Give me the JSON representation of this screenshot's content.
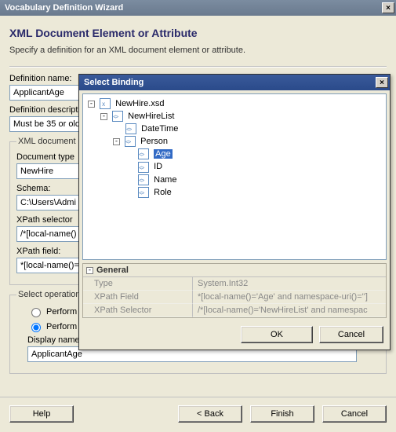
{
  "wizard": {
    "title": "Vocabulary Definition Wizard",
    "header": "XML Document Element or Attribute",
    "description": "Specify a definition for an XML document element or attribute.",
    "fields": {
      "definition_name_label": "Definition name:",
      "definition_name_value": "ApplicantAge",
      "definition_desc_label": "Definition descripti",
      "definition_desc_value": "Must be 35 or olde",
      "xml_group_label": "XML document i",
      "document_type_label": "Document type",
      "document_type_value": "NewHire",
      "schema_label": "Schema:",
      "schema_value": "C:\\Users\\Admi",
      "xpath_selector_label": "XPath selector",
      "xpath_selector_value": "/*[local-name()",
      "xpath_field_label": "XPath field:",
      "xpath_field_value": "*[local-name()="
    },
    "operation": {
      "group_label": "Select operation",
      "radio_set": "Perform \"Se",
      "radio_get": "Perform \"Ge",
      "display_name_label": "Display name:",
      "display_name_value": "ApplicantAge"
    },
    "buttons": {
      "help": "Help",
      "back": "< Back",
      "finish": "Finish",
      "cancel": "Cancel"
    }
  },
  "binding": {
    "title": "Select Binding",
    "tree": {
      "root": "NewHire.xsd",
      "n1": "NewHireList",
      "n1_1": "DateTime",
      "n1_2": "Person",
      "n1_2_1": "Age",
      "n1_2_2": "ID",
      "n1_2_3": "Name",
      "n1_2_4": "Role"
    },
    "props": {
      "header": "General",
      "type_k": "Type",
      "type_v": "System.Int32",
      "xfield_k": "XPath Field",
      "xfield_v": "*[local-name()='Age' and namespace-uri()='']",
      "xsel_k": "XPath Selector",
      "xsel_v": "/*[local-name()='NewHireList' and namespac"
    },
    "buttons": {
      "ok": "OK",
      "cancel": "Cancel"
    }
  }
}
